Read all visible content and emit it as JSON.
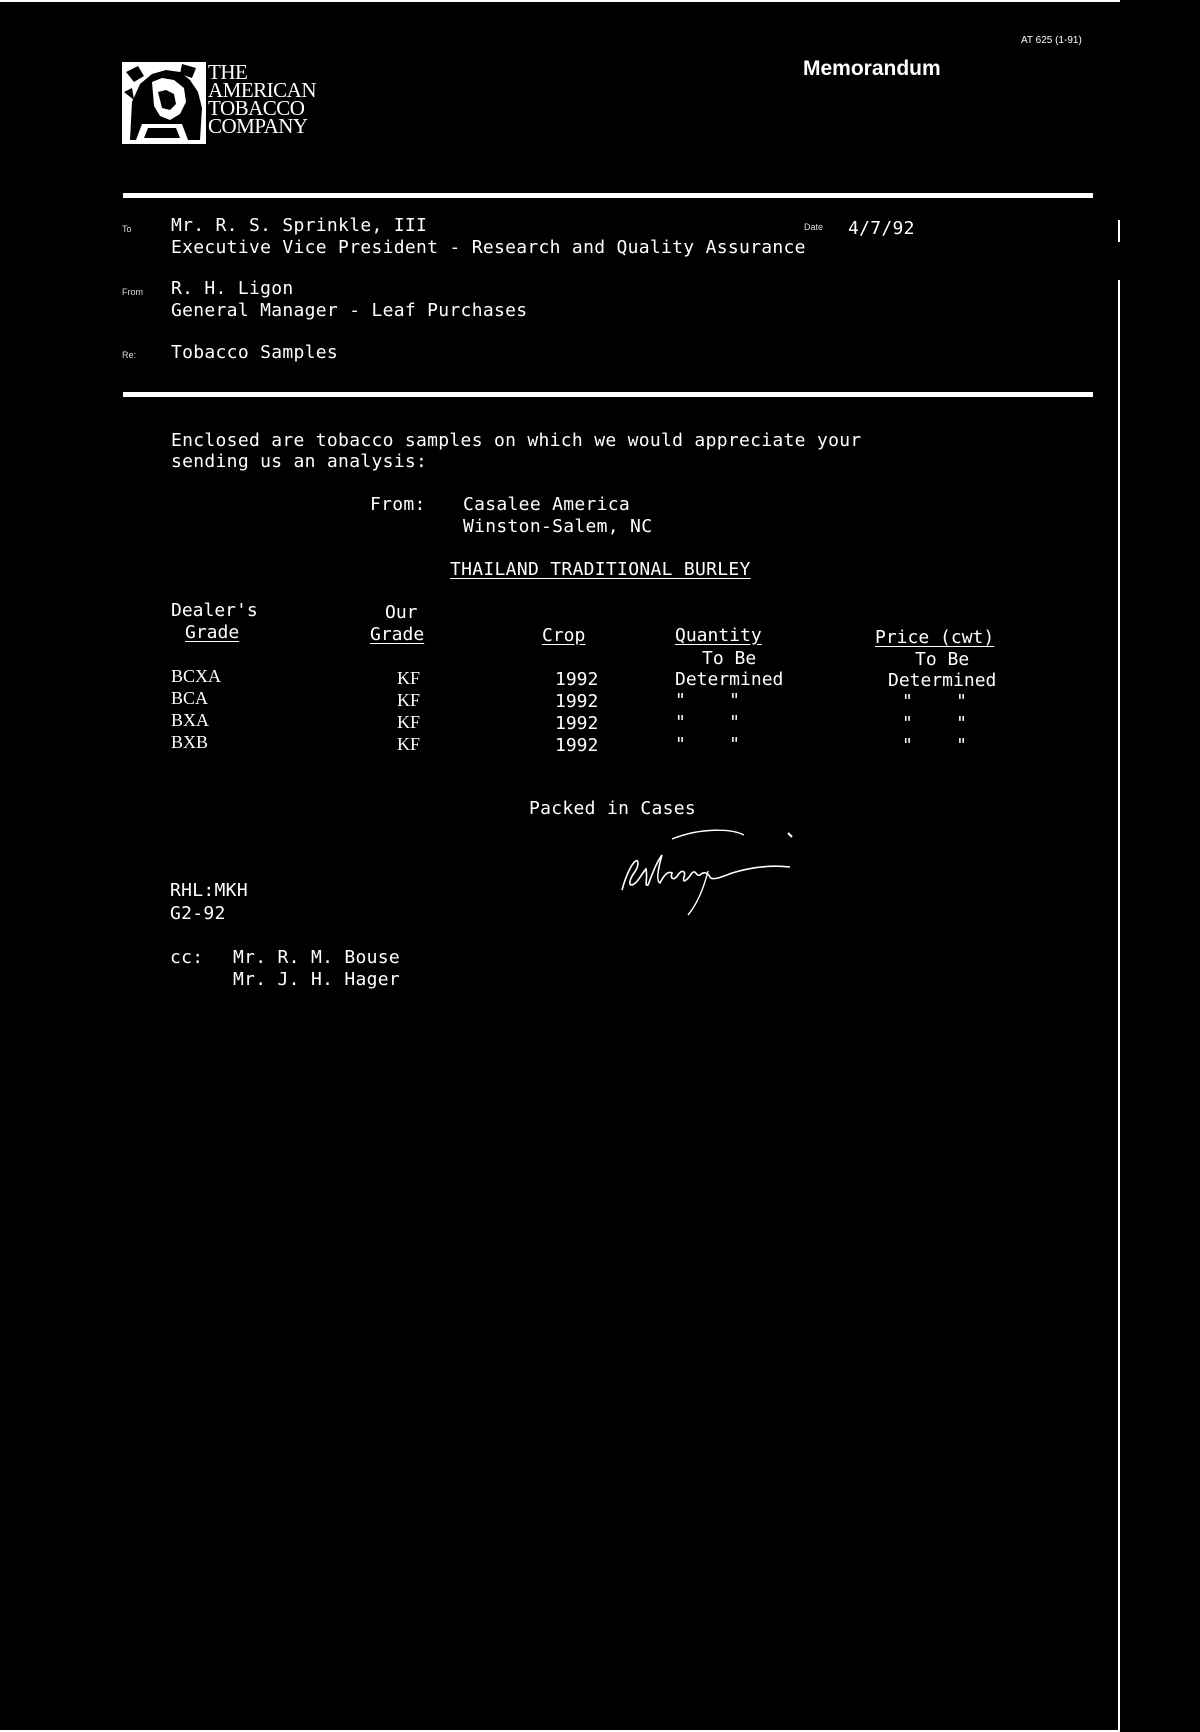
{
  "header": {
    "form_number": "AT 625 (1-91)",
    "title": "Memorandum",
    "company_lines": [
      "THE",
      "AMERICAN",
      "TOBACCO",
      "COMPANY"
    ]
  },
  "fields": {
    "to_label": "To",
    "to_name": "Mr. R. S. Sprinkle, III",
    "to_title": "Executive Vice President - Research and Quality Assurance",
    "date_label": "Date",
    "date_value": "4/7/92",
    "from_label": "From",
    "from_name": "R. H. Ligon",
    "from_title": "General Manager - Leaf Purchases",
    "re_label": "Re:",
    "re_value": "Tobacco Samples"
  },
  "body": {
    "intro_line1": "Enclosed are tobacco samples on which we would appreciate your",
    "intro_line2": "sending us an analysis:",
    "from_label": "From:",
    "source_line1": "Casalee America",
    "source_line2": "Winston-Salem, NC",
    "section_heading": "THAILAND TRADITIONAL BURLEY"
  },
  "table": {
    "headers": {
      "dealer_top": "Dealer's",
      "dealer_bottom": "Grade",
      "our_top": "Our",
      "our_bottom": "Grade",
      "crop": "Crop",
      "quantity": "Quantity",
      "price": "Price (cwt)"
    },
    "first_row_note": {
      "quantity_top": "To Be",
      "quantity_bottom": "Determined",
      "price_top": "To Be",
      "price_bottom": "Determined"
    },
    "rows": [
      {
        "dealer": "BCXA",
        "our": "KF",
        "crop": "1992"
      },
      {
        "dealer": "BCA",
        "our": "KF",
        "crop": "1992",
        "ditto": "\"    \""
      },
      {
        "dealer": "BXA",
        "our": "KF",
        "crop": "1992",
        "ditto": "\"    \""
      },
      {
        "dealer": "BXB",
        "our": "KF",
        "crop": "1992",
        "ditto": "\"    \""
      }
    ]
  },
  "footer": {
    "packed": "Packed in Cases",
    "signature": "RHLigon",
    "initials": "RHL:MKH",
    "code": "G2-92",
    "cc_label": "cc:",
    "cc_1": "Mr. R. M. Bouse",
    "cc_2": "Mr. J. H. Hager"
  }
}
